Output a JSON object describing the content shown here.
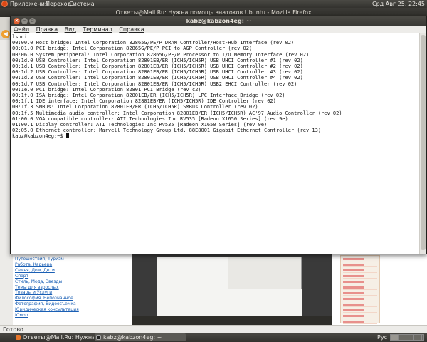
{
  "top_panel": {
    "menus": [
      "Приложения",
      "Переход",
      "Система"
    ],
    "clock": "Срд Авг 25, 22:45"
  },
  "firefox": {
    "window_title": "Ответы@Mail.Ru: Нужна помощь знатоков Ubuntu - Mozilla Firefox",
    "status_text": "Готово",
    "left_links": [
      "Путешествия, Туризм",
      "Работа, Карьера",
      "Семья, Дом, Дети",
      "Спорт",
      "Стиль, Мода, Звезды",
      "Темы для взрослых",
      "Товары и Услуги",
      "Философия, Непознанное",
      "Фотография, Видеосъемка",
      "Юридическая консультация",
      "Юмор"
    ]
  },
  "terminal": {
    "title": "kabz@kabzon4eg: ~",
    "menu": [
      "Файл",
      "Правка",
      "Вид",
      "Терминал",
      "Справка"
    ],
    "lines": [
      "lspci",
      "00:00.0 Host bridge: Intel Corporation 82865G/PE/P DRAM Controller/Host-Hub Interface (rev 02)",
      "00:01.0 PCI bridge: Intel Corporation 82865G/PE/P PCI to AGP Controller (rev 02)",
      "00:06.0 System peripheral: Intel Corporation 82865G/PE/P Processor to I/O Memory Interface (rev 02)",
      "00:1d.0 USB Controller: Intel Corporation 82801EB/ER (ICH5/ICH5R) USB UHCI Controller #1 (rev 02)",
      "00:1d.1 USB Controller: Intel Corporation 82801EB/ER (ICH5/ICH5R) USB UHCI Controller #2 (rev 02)",
      "00:1d.2 USB Controller: Intel Corporation 82801EB/ER (ICH5/ICH5R) USB UHCI Controller #3 (rev 02)",
      "00:1d.3 USB Controller: Intel Corporation 82801EB/ER (ICH5/ICH5R) USB UHCI Controller #4 (rev 02)",
      "00:1d.7 USB Controller: Intel Corporation 82801EB/ER (ICH5/ICH5R) USB2 EHCI Controller (rev 02)",
      "00:1e.0 PCI bridge: Intel Corporation 82801 PCI Bridge (rev c2)",
      "00:1f.0 ISA bridge: Intel Corporation 82801EB/ER (ICH5/ICH5R) LPC Interface Bridge (rev 02)",
      "00:1f.1 IDE interface: Intel Corporation 82801EB/ER (ICH5/ICH5R) IDE Controller (rev 02)",
      "00:1f.3 SMBus: Intel Corporation 82801EB/ER (ICH5/ICH5R) SMBus Controller (rev 02)",
      "00:1f.5 Multimedia audio controller: Intel Corporation 82801EB/ER (ICH5/ICH5R) AC'97 Audio Controller (rev 02)",
      "01:00.0 VGA compatible controller: ATI Technologies Inc RV535 [Radeon X1650 Series] (rev 9e)",
      "01:00.1 Display controller: ATI Technologies Inc RV535 [Radeon X1650 Series] (rev 9e)",
      "02:05.0 Ethernet controller: Marvell Technology Group Ltd. 88E8001 Gigabit Ethernet Controller (rev 13)"
    ],
    "prompt": "kabz@kabzon4eg:~$ "
  },
  "bottom_panel": {
    "tasks": [
      {
        "label": "Ответы@Mail.Ru: Нужна ...",
        "icon": "firefox-icon"
      },
      {
        "label": "kabz@kabzon4eg: ~",
        "icon": "terminal-icon"
      }
    ],
    "keyboard_layout": "Рус"
  },
  "colors": {
    "accent": "#dd4814",
    "panel": "#3c3b37",
    "link": "#1a5fb4"
  }
}
